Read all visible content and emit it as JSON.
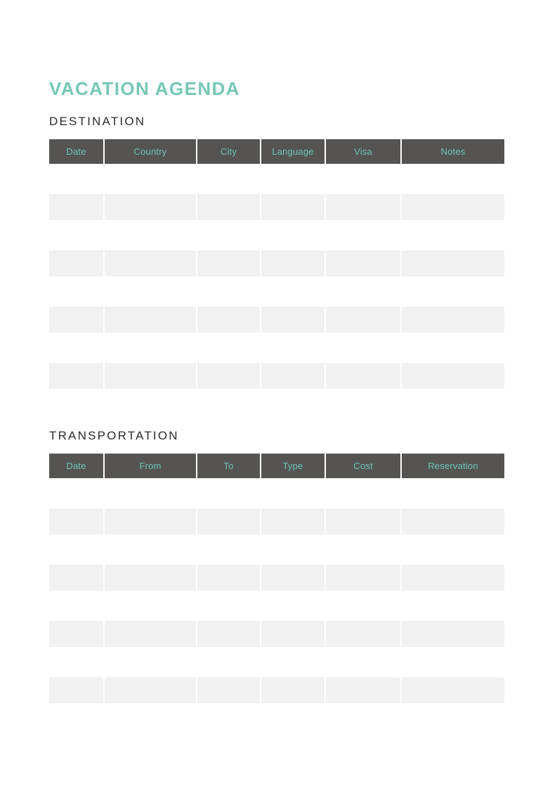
{
  "document": {
    "title": "VACATION AGENDA",
    "title_color": "#76c7b7",
    "background_color": "#ffffff"
  },
  "theme": {
    "accent_teal": "#76c7b7",
    "header_teal_text": "#6ec6b4",
    "header_row_background": "#555453",
    "data_cell_background": "#f1f1f1",
    "section_title_color": "#2b2b2b",
    "cell_separator_color": "#ffffff"
  },
  "sections": [
    {
      "id": "destination",
      "title": "DESTINATION",
      "columns": [
        {
          "label": "Date"
        },
        {
          "label": "Country"
        },
        {
          "label": "City"
        },
        {
          "label": "Language"
        },
        {
          "label": "Visa"
        },
        {
          "label": "Notes"
        }
      ],
      "rows": [
        {
          "Date": "",
          "Country": "",
          "City": "",
          "Language": "",
          "Visa": "",
          "Notes": ""
        },
        {
          "Date": "",
          "Country": "",
          "City": "",
          "Language": "",
          "Visa": "",
          "Notes": ""
        },
        {
          "Date": "",
          "Country": "",
          "City": "",
          "Language": "",
          "Visa": "",
          "Notes": ""
        },
        {
          "Date": "",
          "Country": "",
          "City": "",
          "Language": "",
          "Visa": "",
          "Notes": ""
        }
      ]
    },
    {
      "id": "transportation",
      "title": "TRANSPORTATION",
      "columns": [
        {
          "label": "Date"
        },
        {
          "label": "From"
        },
        {
          "label": "To"
        },
        {
          "label": "Type"
        },
        {
          "label": "Cost"
        },
        {
          "label": "Reservation"
        }
      ],
      "rows": [
        {
          "Date": "",
          "From": "",
          "To": "",
          "Type": "",
          "Cost": "",
          "Reservation": ""
        },
        {
          "Date": "",
          "From": "",
          "To": "",
          "Type": "",
          "Cost": "",
          "Reservation": ""
        },
        {
          "Date": "",
          "From": "",
          "To": "",
          "Type": "",
          "Cost": "",
          "Reservation": ""
        },
        {
          "Date": "",
          "From": "",
          "To": "",
          "Type": "",
          "Cost": "",
          "Reservation": ""
        }
      ]
    }
  ]
}
